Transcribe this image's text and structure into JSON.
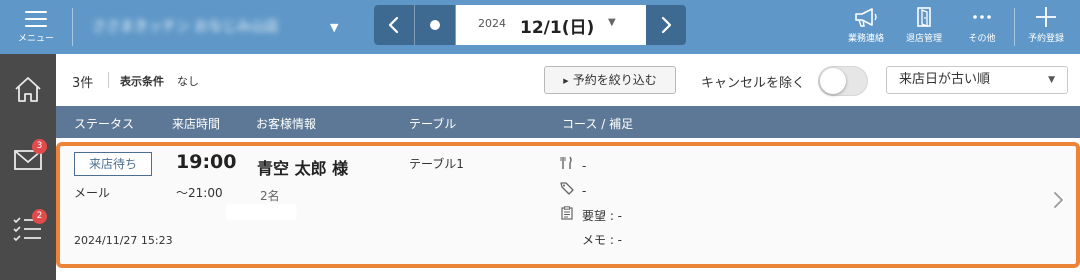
{
  "topbar": {
    "menu_label": "メニュー",
    "store_name": "ささまきッチン おなじみ山店",
    "date": {
      "year": "2024",
      "date": "12/1(日)"
    },
    "tools": [
      {
        "label": "業務連絡",
        "icon": "megaphone-icon"
      },
      {
        "label": "退店管理",
        "icon": "exit-door-icon"
      },
      {
        "label": "その他",
        "icon": "more-dots-icon"
      },
      {
        "label": "予約登録",
        "icon": "plus-icon"
      }
    ]
  },
  "sidebar": {
    "items": [
      {
        "name": "home",
        "icon": "home-icon",
        "badge": ""
      },
      {
        "name": "messages",
        "icon": "mail-icon",
        "badge": "3"
      },
      {
        "name": "tasks",
        "icon": "checklist-icon",
        "badge": "2"
      }
    ]
  },
  "filters": {
    "count": "3件",
    "condition_label": "表示条件",
    "condition_value": "なし",
    "narrow_button": "予約を絞り込む",
    "exclude_cancel_label": "キャンセルを除く",
    "exclude_cancel": false,
    "sort_selected": "来店日が古い順"
  },
  "table": {
    "headers": [
      "ステータス",
      "来店時間",
      "お客様情報",
      "テーブル",
      "コース / 補足"
    ]
  },
  "reservation": {
    "status": "来店待ち",
    "source": "メール",
    "created": "2024/11/27 15:23",
    "time": "19:00",
    "end_time": "～21:00",
    "guest_name": "青空 太郎 様",
    "party_size": "2名",
    "table": "テーブル1",
    "course": "-",
    "coupon": "-",
    "request": "要望 : -",
    "memo": "メモ : -"
  },
  "colors": {
    "topbar": "#5f98c8",
    "date_nav": "#3e6a92",
    "sidebar": "#4a4a4a",
    "table_header": "#5d7896",
    "highlight_border": "#ec8437",
    "badge": "#e14b4b"
  }
}
